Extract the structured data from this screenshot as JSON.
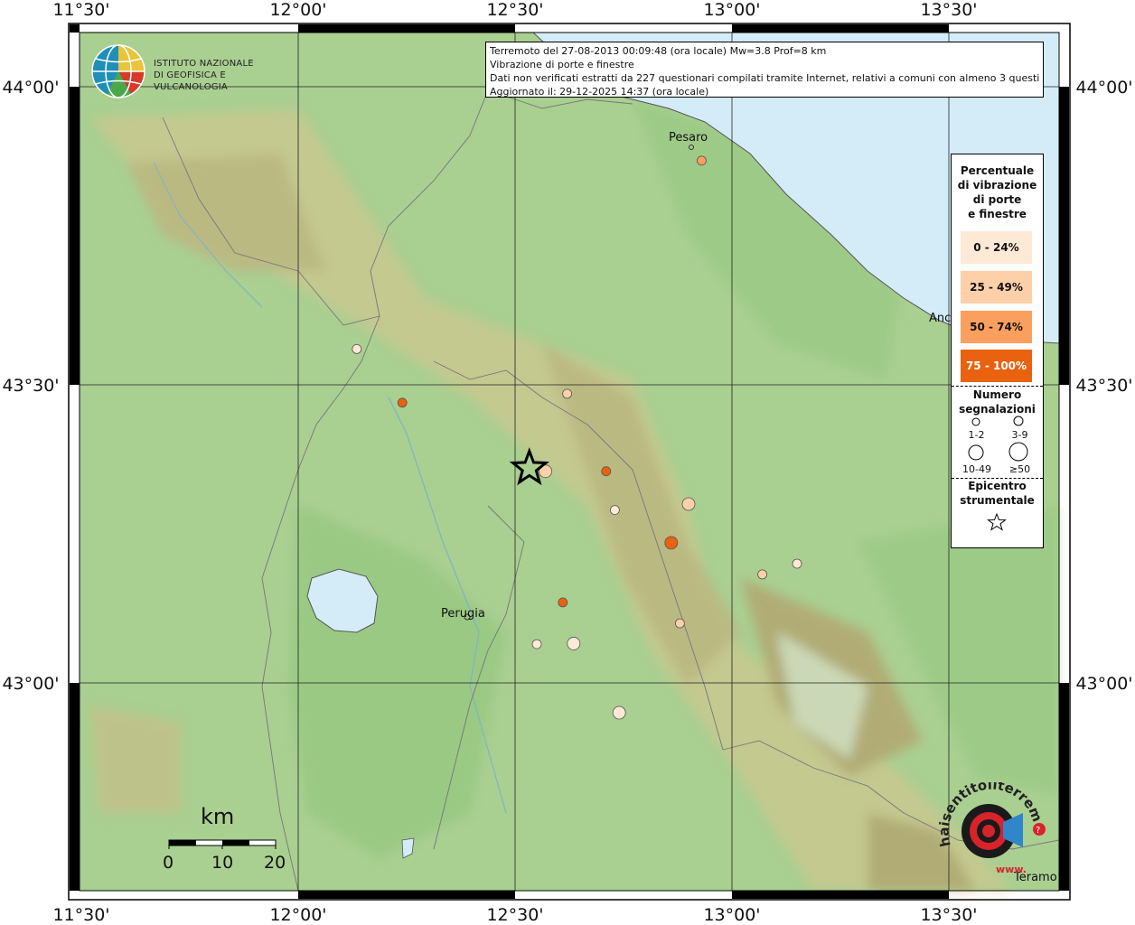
{
  "grid": {
    "lon_labels": [
      "11°30'",
      "12°00'",
      "12°30'",
      "13°00'",
      "13°30'"
    ],
    "lat_labels": [
      "44°00'",
      "43°30'",
      "43°00'"
    ]
  },
  "info": {
    "line1": "Terremoto del 27-08-2013 00:09:48 (ora locale) Mw=3.8 Prof=8 km",
    "line2": "Vibrazione di porte e finestre",
    "line3": "Dati non verificati estratti da 227 questionari compilati tramite Internet, relativi a comuni con almeno 3 questionari.",
    "line4": "Aggiornato il: 29-12-2025 14:37 (ora locale)"
  },
  "logo": {
    "line1": "ISTITUTO NAZIONALE",
    "line2": "DI GEOFISICA E VULCANOLOGIA"
  },
  "cities": {
    "pesaro": "Pesaro",
    "ancona": "Anc",
    "perugia": "Perugia",
    "teramo": "Teramo"
  },
  "legend": {
    "title1": "Percentuale",
    "title2": "di vibrazione",
    "title3": "di porte",
    "title4": "e finestre",
    "classes": [
      {
        "label": "0 - 24%",
        "color": "#fde9d5"
      },
      {
        "label": "25 - 49%",
        "color": "#fdd0aa"
      },
      {
        "label": "50 - 74%",
        "color": "#fb9f5e"
      },
      {
        "label": "75 - 100%",
        "color": "#e8620f"
      }
    ],
    "count_title1": "Numero",
    "count_title2": "segnalazioni",
    "count_1": "1-2",
    "count_2": "3-9",
    "count_3": "10-49",
    "count_4": "≥50",
    "epi_title1": "Epicentro",
    "epi_title2": "strumentale"
  },
  "scale": {
    "unit": "km",
    "t0": "0",
    "t1": "10",
    "t2": "20"
  },
  "badge": {
    "text": "haisentitoilterremoto.it",
    "www": "www."
  },
  "colors": {
    "land": "#a9cf91",
    "sea": "#d4ecf8",
    "relief": "#c9a877"
  },
  "epicenter": {
    "lon": 12.533,
    "lat": 43.36
  },
  "points": [
    {
      "lon": 12.93,
      "lat": 43.876,
      "class": 2,
      "count": 2
    },
    {
      "lon": 12.135,
      "lat": 43.56,
      "class": 0,
      "count": 2
    },
    {
      "lon": 12.24,
      "lat": 43.47,
      "class": 3,
      "count": 2
    },
    {
      "lon": 12.62,
      "lat": 43.485,
      "class": 1,
      "count": 2
    },
    {
      "lon": 12.57,
      "lat": 43.355,
      "class": 1,
      "count": 4
    },
    {
      "lon": 12.71,
      "lat": 43.355,
      "class": 3,
      "count": 2
    },
    {
      "lon": 12.9,
      "lat": 43.3,
      "class": 1,
      "count": 3
    },
    {
      "lon": 12.73,
      "lat": 43.29,
      "class": 0,
      "count": 2
    },
    {
      "lon": 12.86,
      "lat": 43.235,
      "class": 3,
      "count": 3
    },
    {
      "lon": 13.15,
      "lat": 43.2,
      "class": 0,
      "count": 2
    },
    {
      "lon": 13.07,
      "lat": 43.182,
      "class": 1,
      "count": 2
    },
    {
      "lon": 12.61,
      "lat": 43.135,
      "class": 3,
      "count": 2
    },
    {
      "lon": 12.88,
      "lat": 43.1,
      "class": 1,
      "count": 2
    },
    {
      "lon": 12.55,
      "lat": 43.065,
      "class": 0,
      "count": 2
    },
    {
      "lon": 12.635,
      "lat": 43.066,
      "class": 0,
      "count": 3
    },
    {
      "lon": 12.74,
      "lat": 42.95,
      "class": 0,
      "count": 3
    }
  ]
}
